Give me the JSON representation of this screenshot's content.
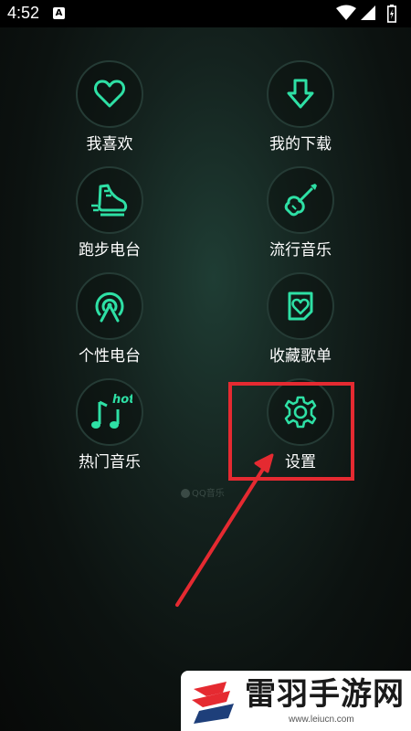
{
  "status_bar": {
    "time": "4:52",
    "app_icon_letter": "A"
  },
  "menu": {
    "items": [
      {
        "label": "我喜欢",
        "icon": "heart-icon"
      },
      {
        "label": "我的下载",
        "icon": "download-icon"
      },
      {
        "label": "跑步电台",
        "icon": "running-shoe-icon"
      },
      {
        "label": "流行音乐",
        "icon": "guitar-icon"
      },
      {
        "label": "个性电台",
        "icon": "radio-broadcast-icon"
      },
      {
        "label": "收藏歌单",
        "icon": "favorite-playlist-icon"
      },
      {
        "label": "热门音乐",
        "icon": "hot-music-icon"
      },
      {
        "label": "设置",
        "icon": "gear-icon"
      }
    ],
    "hot_badge": "hot"
  },
  "watermark": {
    "text": "QQ音乐"
  },
  "annotation": {
    "color": "#e52a31"
  },
  "logo": {
    "title": "雷羽手游网",
    "url": "www.leiucn.com"
  },
  "colors": {
    "icon_green": "#2ee0a5",
    "circle_border": "#253b35"
  }
}
